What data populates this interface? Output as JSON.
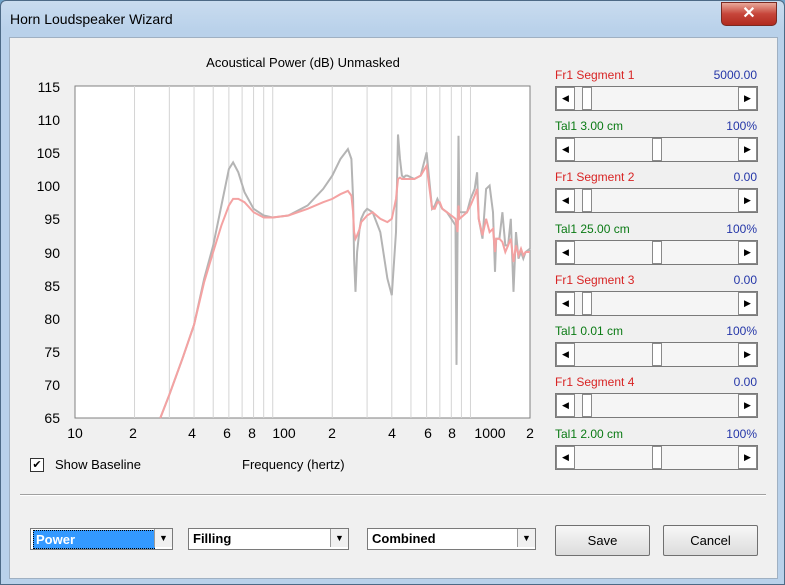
{
  "window": {
    "title": "Horn Loudspeaker Wizard",
    "close_glyph": "✕"
  },
  "chart": {
    "title": "Acoustical Power (dB)   Unmasked",
    "ylabels": [
      "115",
      "110",
      "105",
      "100",
      "95",
      "90",
      "85",
      "80",
      "75",
      "70",
      "65"
    ],
    "xlabels": [
      "10",
      "2",
      "4",
      "6",
      "8",
      "100",
      "2",
      "4",
      "6",
      "8",
      "1000",
      "2"
    ]
  },
  "chart_data": {
    "type": "line",
    "title": "Acoustical Power (dB)   Unmasked",
    "xlabel": "Frequency (hertz)",
    "ylabel": "",
    "xscale": "log",
    "xlim": [
      10,
      2000
    ],
    "ylim": [
      65,
      115
    ],
    "grid": true,
    "colors": {
      "gray_series": "#b4b4b4",
      "pink_series": "#f4a2a2"
    },
    "series": [
      {
        "x": [
          27,
          30,
          35,
          40,
          45,
          50,
          55,
          60,
          63,
          67,
          72,
          80,
          90,
          100,
          120,
          150,
          180,
          200,
          220,
          240,
          250,
          255,
          258,
          262,
          267,
          275,
          280,
          290,
          300,
          320,
          350,
          380,
          400,
          420,
          430,
          440,
          450,
          460,
          470,
          480,
          520,
          560,
          600,
          640,
          660,
          680,
          700,
          720,
          760,
          800,
          840,
          850,
          860,
          870,
          880,
          920,
          960,
          1000,
          1050,
          1080,
          1100,
          1150,
          1200,
          1250,
          1300,
          1330,
          1350,
          1400,
          1450,
          1500,
          1550,
          1600,
          1650,
          1700,
          1750,
          1800,
          1850,
          1900,
          2000
        ],
        "y": [
          65,
          68.5,
          74,
          79,
          86,
          91,
          97,
          102.5,
          103.5,
          102,
          99,
          96.5,
          95.5,
          95.2,
          95.5,
          97,
          99.5,
          101.5,
          104,
          105.5,
          104,
          98,
          89,
          84,
          90,
          93.5,
          95,
          96,
          96.5,
          96,
          93,
          86,
          83.5,
          93,
          107.7,
          104,
          101.5,
          101.2,
          101.5,
          101.5,
          101,
          101.5,
          105,
          96.5,
          97,
          98,
          97.2,
          96.5,
          96,
          95,
          94,
          73,
          91.5,
          107.5,
          96,
          96,
          96,
          98,
          99.5,
          102,
          95,
          92,
          99.5,
          100,
          96,
          87,
          92,
          92,
          96,
          91,
          91,
          95,
          84,
          93,
          89,
          90,
          89,
          90,
          90.5
        ]
      },
      {
        "x": [
          27,
          30,
          35,
          40,
          45,
          50,
          55,
          60,
          63,
          67,
          72,
          80,
          90,
          100,
          120,
          150,
          180,
          200,
          220,
          240,
          250,
          255,
          258,
          262,
          267,
          275,
          280,
          290,
          300,
          320,
          350,
          380,
          400,
          420,
          430,
          440,
          450,
          460,
          470,
          480,
          520,
          560,
          600,
          640,
          660,
          680,
          700,
          720,
          760,
          800,
          840,
          850,
          860,
          870,
          880,
          920,
          960,
          1000,
          1050,
          1080,
          1100,
          1150,
          1200,
          1250,
          1300,
          1330,
          1350,
          1400,
          1450,
          1500,
          1550,
          1600,
          1650,
          1700,
          1750,
          1800,
          1850,
          1900,
          2000
        ],
        "y": [
          65,
          68.5,
          74,
          79,
          85.5,
          90,
          94,
          97,
          98,
          98,
          97.5,
          96,
          95.2,
          95.2,
          95.5,
          96.5,
          97.5,
          98,
          98.7,
          99.2,
          98.5,
          96,
          93,
          92,
          92.5,
          93.5,
          94.5,
          95,
          95.5,
          96,
          95,
          94.5,
          95,
          98,
          101,
          101.2,
          101,
          101,
          101,
          101,
          101,
          101.5,
          103,
          96.5,
          96.5,
          97.5,
          97.5,
          96.5,
          96,
          95.5,
          95,
          94,
          93,
          97,
          95,
          95.5,
          96,
          97,
          98.5,
          99.5,
          95,
          92.5,
          95,
          93,
          93.5,
          90,
          92,
          92,
          91.5,
          90,
          91,
          92,
          88.5,
          91,
          89.5,
          90.5,
          89.5,
          90,
          90
        ]
      }
    ]
  },
  "baseline": {
    "label": "Show Baseline",
    "checked": true,
    "check_glyph": "✔"
  },
  "xaxis_label": "Frequency (hertz)",
  "controls": [
    {
      "label": "Fr1  Segment 1",
      "value": "5000.00",
      "color": "red",
      "thumb": 0.0
    },
    {
      "label": "Tal1  3.00 cm",
      "value": "100%",
      "color": "green",
      "thumb": 0.49
    },
    {
      "label": "Fr1  Segment 2",
      "value": "0.00",
      "color": "red",
      "thumb": 0.0
    },
    {
      "label": "Tal1  25.00 cm",
      "value": "100%",
      "color": "green",
      "thumb": 0.49
    },
    {
      "label": "Fr1  Segment 3",
      "value": "0.00",
      "color": "red",
      "thumb": 0.0
    },
    {
      "label": "Tal1  0.01 cm",
      "value": "100%",
      "color": "green",
      "thumb": 0.49
    },
    {
      "label": "Fr1  Segment 4",
      "value": "0.00",
      "color": "red",
      "thumb": 0.0
    },
    {
      "label": "Tal1  2.00 cm",
      "value": "100%",
      "color": "green",
      "thumb": 0.49
    }
  ],
  "arrows": {
    "left": "◀",
    "right": "▶",
    "down": "▼"
  },
  "selects": {
    "mode": "Power",
    "fill": "Filling",
    "combine": "Combined"
  },
  "buttons": {
    "save": "Save",
    "cancel": "Cancel"
  }
}
